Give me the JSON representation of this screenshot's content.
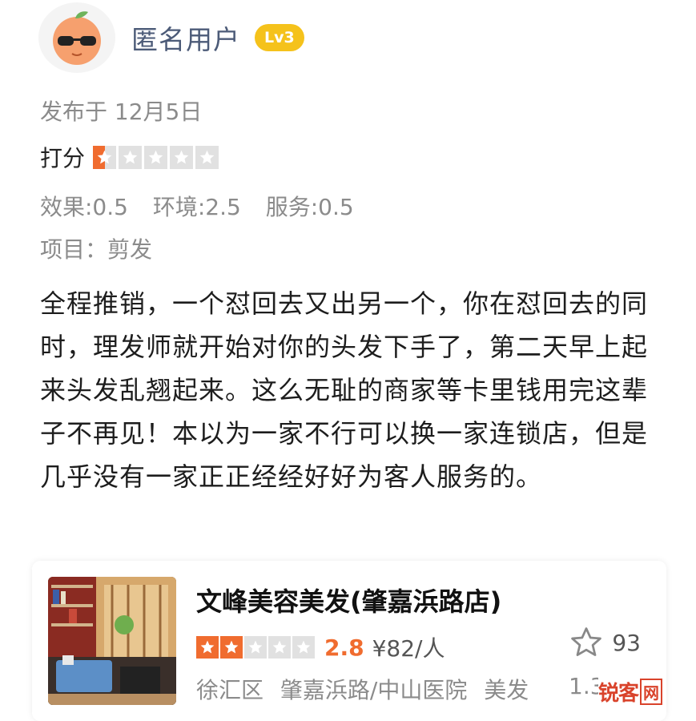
{
  "user": {
    "name": "匿名用户",
    "level": "Lv3",
    "avatar_icon": "orange-with-sunglasses-icon"
  },
  "review": {
    "publish_date": "发布于 12月5日",
    "rating_label": "打分",
    "rating_value": 0.5,
    "rating_max": 5,
    "scores": [
      "效果:0.5",
      "环境:2.5",
      "服务:0.5"
    ],
    "project": "项目：剪发",
    "text": "全程推销，一个怼回去又出另一个，你在怼回去的同时，理发师就开始对你的头发下手了，第二天早上起来头发乱翘起来。这么无耻的商家等卡里钱用完这辈子不再见！本以为一家不行可以换一家连锁店，但是几乎没有一家正正经经好好为客人服务的。"
  },
  "shop": {
    "name": "文峰美容美发(肇嘉浜路店)",
    "rating_stars": 2,
    "rating_max": 5,
    "score": "2.8",
    "price": "¥82/人",
    "favorite_count": "93",
    "district": "徐汇区",
    "area": "肇嘉浜路/中山医院",
    "category": "美发",
    "distance": "1.3k"
  },
  "watermark": {
    "text": "锐客",
    "box": "网"
  },
  "colors": {
    "star_active": "#f06c2f",
    "star_inactive": "#e1e1e1",
    "level_badge": "#f5c21b",
    "username": "#4c5b78"
  }
}
